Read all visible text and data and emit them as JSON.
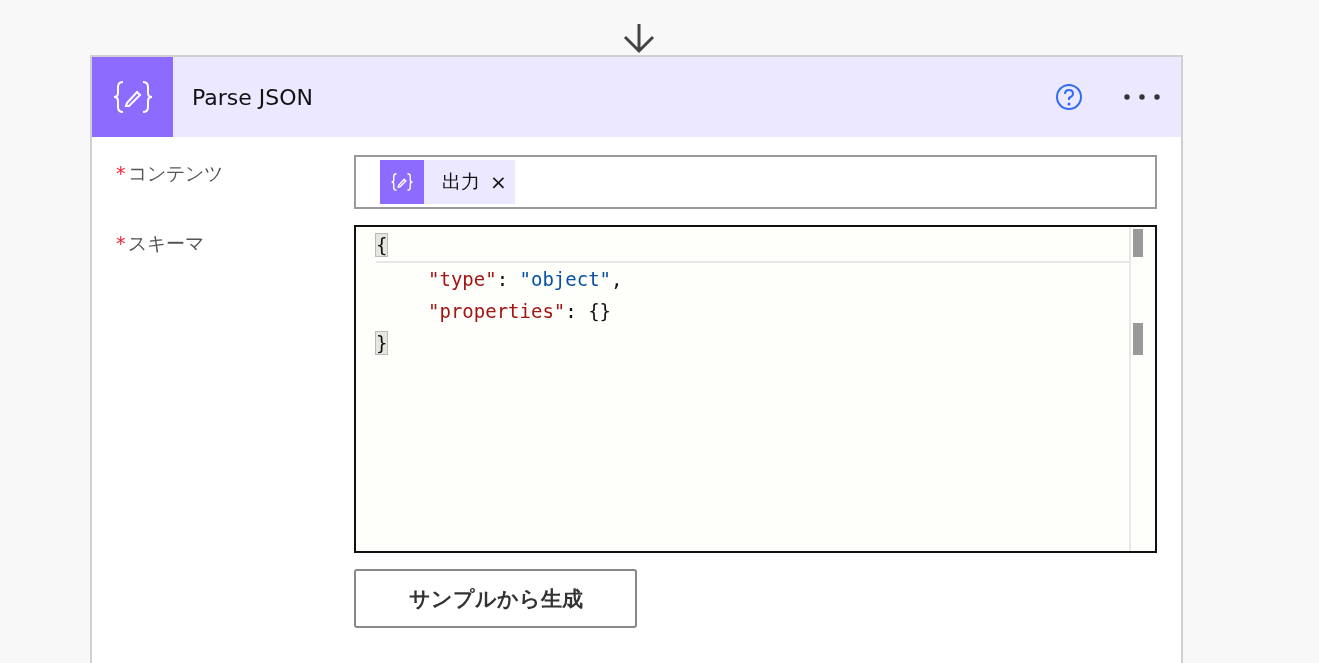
{
  "action": {
    "title": "Parse JSON"
  },
  "fields": [
    {
      "required_mark": "*",
      "label": "コンテンツ",
      "kind": "tokens",
      "tokens": [
        {
          "label": "出力",
          "remove": "×"
        }
      ]
    },
    {
      "required_mark": "*",
      "label": "スキーマ",
      "kind": "code",
      "lines": [
        {
          "indented": false,
          "tokens": [
            {
              "kind": "bracket",
              "text": "{"
            }
          ]
        },
        {
          "indented": true,
          "tokens": [
            {
              "kind": "key",
              "text": "\"type\""
            },
            {
              "kind": "punct",
              "text": ": "
            },
            {
              "kind": "string",
              "text": "\"object\""
            },
            {
              "kind": "punct",
              "text": ","
            }
          ]
        },
        {
          "indented": true,
          "tokens": [
            {
              "kind": "key",
              "text": "\"properties\""
            },
            {
              "kind": "punct",
              "text": ": {}"
            }
          ]
        },
        {
          "indented": false,
          "tokens": [
            {
              "kind": "bracket",
              "text": "}"
            }
          ]
        }
      ]
    }
  ],
  "generate_button": "サンプルから生成"
}
